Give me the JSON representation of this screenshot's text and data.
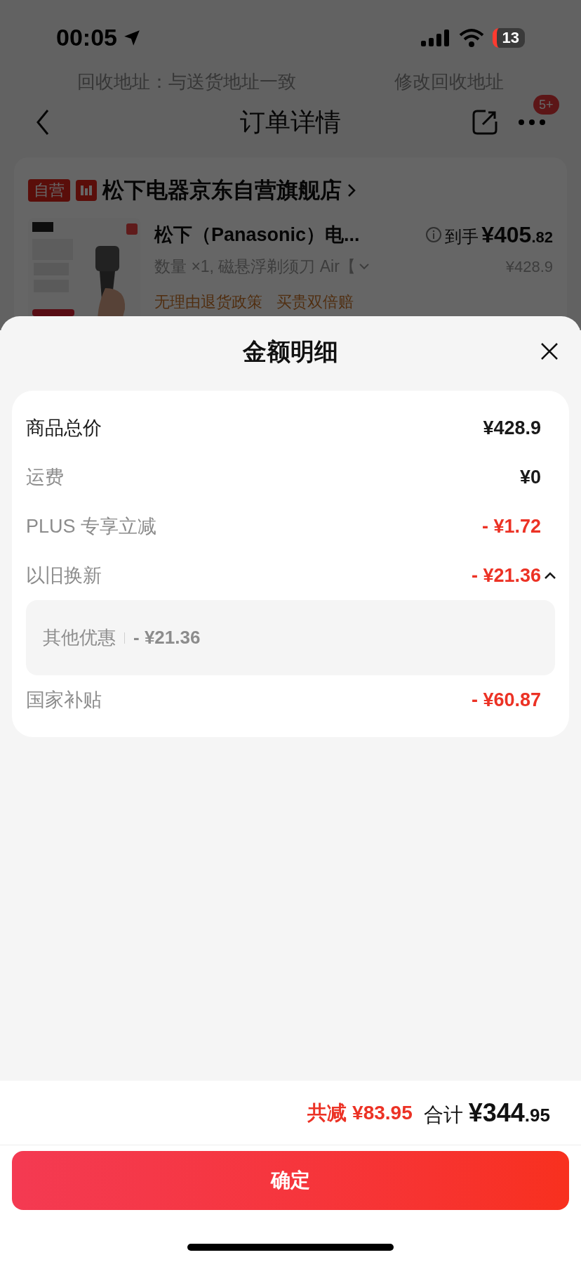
{
  "status_bar": {
    "time": "00:05",
    "battery": "13"
  },
  "background_page": {
    "address_row": {
      "label": "回收地址：与送货地址一致",
      "action": "修改回收地址"
    },
    "nav": {
      "title": "订单详情",
      "badge": "5+"
    },
    "store": {
      "tag": "自营",
      "name": "松下电器京东自营旗舰店"
    },
    "product": {
      "title": "松下（Panasonic）电...",
      "variant": "数量 ×1, 磁悬浮剃须刀 Air【",
      "final_label": "到手",
      "final_main": "¥405",
      "final_decimal": ".82",
      "original_price": "¥428.9",
      "tags": [
        "无理由退货政策",
        "买贵双倍赔"
      ]
    }
  },
  "sheet": {
    "title": "金额明细",
    "rows": [
      {
        "label": "商品总价",
        "value": "¥428.9",
        "emphasis": true,
        "discount": false
      },
      {
        "label": "运费",
        "value": "¥0",
        "emphasis": false,
        "discount": false
      },
      {
        "label": "PLUS 专享立减",
        "value": "- ¥1.72",
        "emphasis": false,
        "discount": true
      },
      {
        "label": "以旧换新",
        "value": "- ¥21.36",
        "emphasis": false,
        "discount": true,
        "expanded": true,
        "children": [
          {
            "label": "其他优惠",
            "value": "- ¥21.36"
          }
        ]
      },
      {
        "label": "国家补贴",
        "value": "- ¥60.87",
        "emphasis": false,
        "discount": true
      }
    ]
  },
  "footer": {
    "saved": "共减 ¥83.95",
    "total_label": "合计",
    "total_main": "¥344",
    "total_decimal": ".95",
    "confirm": "确定"
  }
}
